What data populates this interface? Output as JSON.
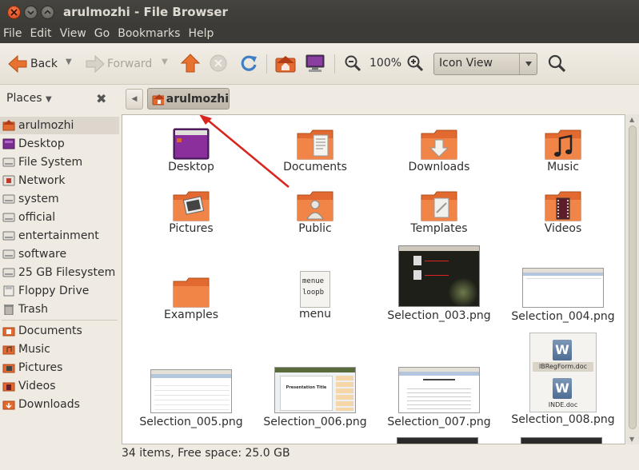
{
  "window": {
    "title": "arulmozhi - File Browser"
  },
  "menubar": [
    "File",
    "Edit",
    "View",
    "Go",
    "Bookmarks",
    "Help"
  ],
  "toolbar": {
    "back": "Back",
    "forward": "Forward",
    "zoom": "100%",
    "view_mode": "Icon View"
  },
  "location": {
    "places_label": "Places",
    "current": "arulmozhi"
  },
  "sidebar": {
    "items": [
      {
        "label": "arulmozhi",
        "icon": "home-folder-icon"
      },
      {
        "label": "Desktop",
        "icon": "desktop-icon"
      },
      {
        "label": "File System",
        "icon": "drive-icon"
      },
      {
        "label": "Network",
        "icon": "network-icon"
      },
      {
        "label": "system",
        "icon": "drive-icon"
      },
      {
        "label": "official",
        "icon": "drive-icon"
      },
      {
        "label": "entertainment",
        "icon": "drive-icon"
      },
      {
        "label": "software",
        "icon": "drive-icon"
      },
      {
        "label": "25 GB Filesystem",
        "icon": "drive-icon"
      },
      {
        "label": "Floppy Drive",
        "icon": "floppy-icon"
      },
      {
        "label": "Trash",
        "icon": "trash-icon"
      },
      {
        "label": "Documents",
        "icon": "folder-icon"
      },
      {
        "label": "Music",
        "icon": "folder-icon"
      },
      {
        "label": "Pictures",
        "icon": "folder-icon"
      },
      {
        "label": "Videos",
        "icon": "folder-icon"
      },
      {
        "label": "Downloads",
        "icon": "folder-icon"
      }
    ]
  },
  "files": [
    {
      "label": "Desktop",
      "icon": "desktop-folder-icon"
    },
    {
      "label": "Documents",
      "icon": "documents-folder-icon"
    },
    {
      "label": "Downloads",
      "icon": "downloads-folder-icon"
    },
    {
      "label": "Music",
      "icon": "music-folder-icon"
    },
    {
      "label": "Pictures",
      "icon": "pictures-folder-icon"
    },
    {
      "label": "Public",
      "icon": "public-folder-icon"
    },
    {
      "label": "Templates",
      "icon": "templates-folder-icon"
    },
    {
      "label": "Videos",
      "icon": "videos-folder-icon"
    },
    {
      "label": "Examples",
      "icon": "folder-icon"
    },
    {
      "label": "menu",
      "icon": "text-file-icon",
      "preview_lines": [
        "menue",
        "loopb"
      ]
    },
    {
      "label": "Selection_003.png",
      "icon": "image-thumbnail-icon"
    },
    {
      "label": "Selection_004.png",
      "icon": "image-thumbnail-icon"
    },
    {
      "label": "Selection_005.png",
      "icon": "image-thumbnail-icon"
    },
    {
      "label": "Selection_006.png",
      "icon": "image-thumbnail-icon",
      "preview_title": "Presentation Title"
    },
    {
      "label": "Selection_007.png",
      "icon": "image-thumbnail-icon"
    },
    {
      "label": "Selection_008.png",
      "icon": "image-thumbnail-icon",
      "preview_files": [
        "IBRegForm.doc",
        "INDE.doc"
      ]
    }
  ],
  "status": {
    "text": "34 items, Free space: 25.0 GB"
  },
  "colors": {
    "folder": "#e2692f",
    "accent_arrow": "#d9251d",
    "titlebar": "#3c3b37"
  }
}
